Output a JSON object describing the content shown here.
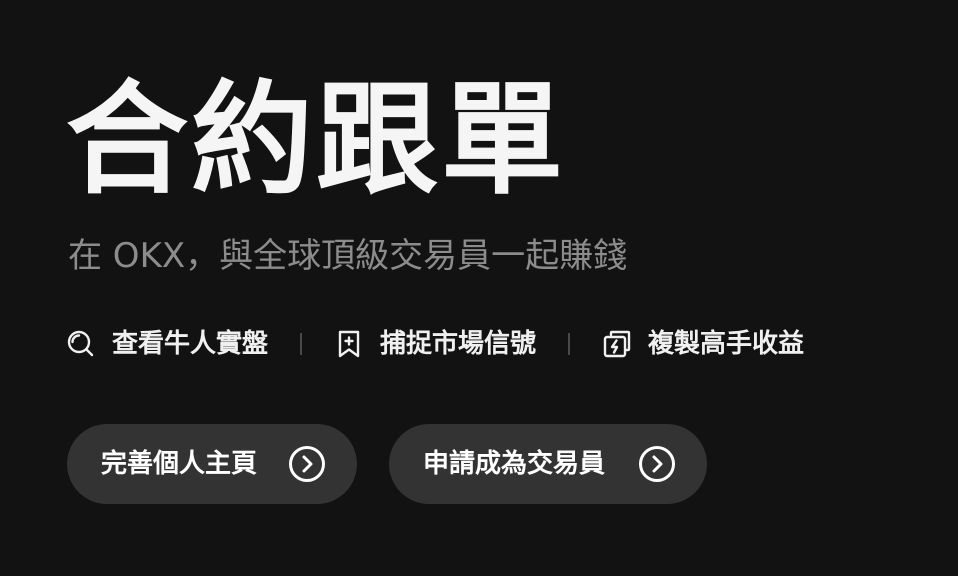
{
  "hero": {
    "title": "合約跟單",
    "subtitle": "在 OKX，與全球頂級交易員一起賺錢"
  },
  "features": [
    {
      "icon": "search-icon",
      "label": "查看牛人實盤"
    },
    {
      "icon": "bookmark-plus-icon",
      "label": "捕捉市場信號"
    },
    {
      "icon": "copy-lightning-icon",
      "label": "複製高手收益"
    }
  ],
  "buttons": [
    {
      "label": "完善個人主頁",
      "icon": "chevron-right-circle-icon"
    },
    {
      "label": "申請成為交易員",
      "icon": "chevron-right-circle-icon"
    }
  ],
  "colors": {
    "background": "#121212",
    "title": "#f5f5f5",
    "subtitle": "#8c8c8c",
    "button_bg": "#333333"
  }
}
